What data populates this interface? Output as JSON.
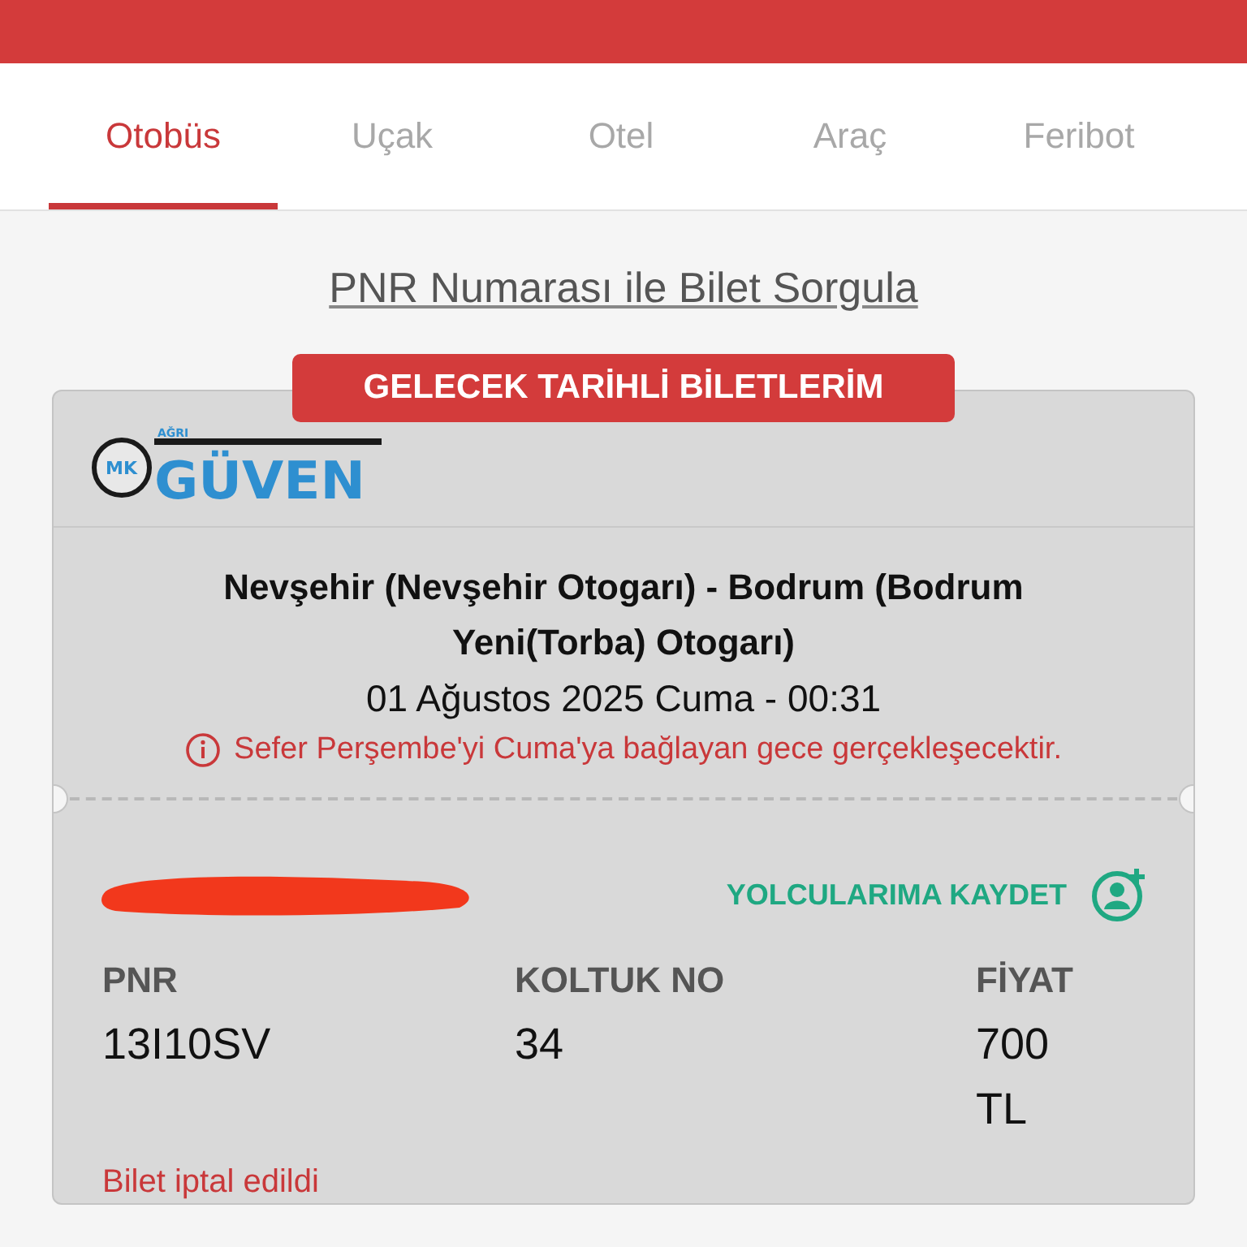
{
  "tabs": [
    {
      "label": "Otobüs",
      "selected": true
    },
    {
      "label": "Uçak",
      "selected": false
    },
    {
      "label": "Otel",
      "selected": false
    },
    {
      "label": "Araç",
      "selected": false
    },
    {
      "label": "Feribot",
      "selected": false
    }
  ],
  "pnr_link": "PNR Numarası ile Bilet Sorgula",
  "section_badge": "GELECEK TARİHLİ BİLETLERİM",
  "ticket": {
    "logo": {
      "mark": "MK",
      "small": "AĞRI",
      "name": "GÜVEN"
    },
    "route": "Nevşehir (Nevşehir Otogarı) - Bodrum (Bodrum Yeni(Torba) Otogarı)",
    "datetime": "01 Ağustos 2025 Cuma - 00:31",
    "warning": "Sefer Perşembe'yi Cuma'ya bağlayan gece gerçekleşecektir.",
    "save_passenger": "YOLCULARIMA KAYDET",
    "fields": [
      {
        "label": "PNR",
        "value": "13I10SV"
      },
      {
        "label": "KOLTUK NO",
        "value": "34"
      },
      {
        "label": "FİYAT",
        "value": "700 TL"
      }
    ],
    "status": "Bilet iptal edildi"
  }
}
